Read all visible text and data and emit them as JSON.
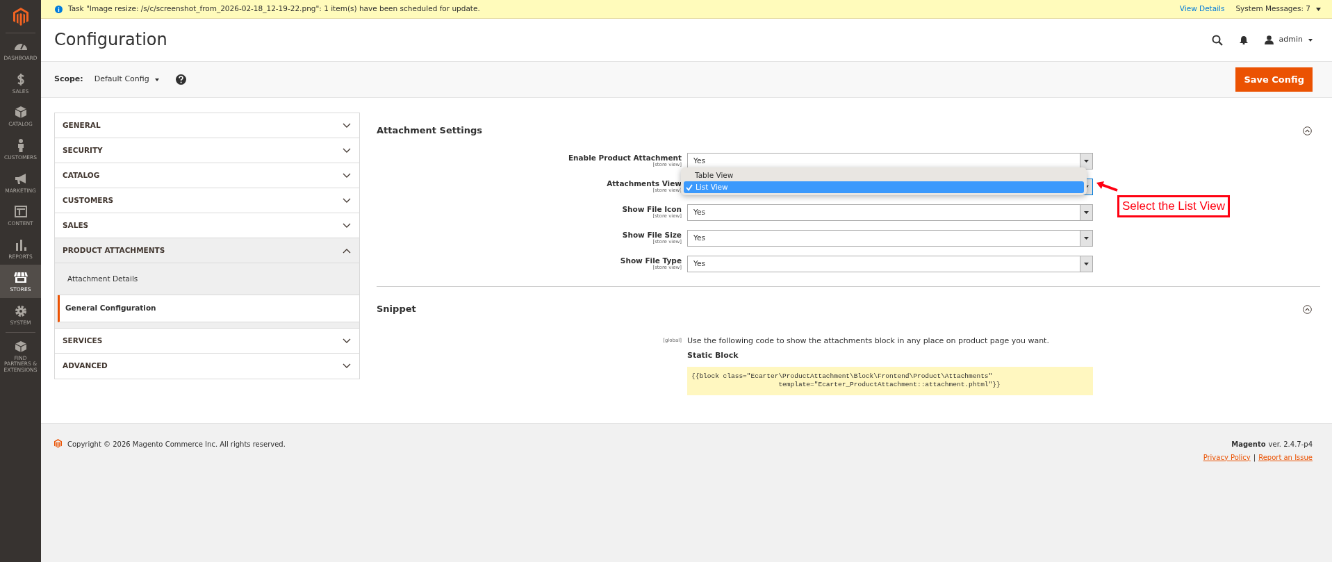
{
  "notice": {
    "text": "Task \"Image resize: /s/c/screenshot_from_2026-02-18_12-19-22.png\": 1 item(s) have been scheduled for update.",
    "link": "View Details",
    "messages": "System Messages: 7"
  },
  "sidebar": {
    "items": [
      {
        "label": "DASHBOARD",
        "selected": false
      },
      {
        "label": "SALES",
        "selected": false
      },
      {
        "label": "CATALOG",
        "selected": false
      },
      {
        "label": "CUSTOMERS",
        "selected": false
      },
      {
        "label": "MARKETING",
        "selected": false
      },
      {
        "label": "CONTENT",
        "selected": false
      },
      {
        "label": "REPORTS",
        "selected": false
      },
      {
        "label": "STORES",
        "selected": true
      },
      {
        "label": "SYSTEM",
        "selected": false
      },
      {
        "label": "FIND PARTNERS & EXTENSIONS",
        "selected": false
      }
    ]
  },
  "header": {
    "title": "Configuration",
    "user": "admin"
  },
  "scope": {
    "label": "Scope:",
    "value": "Default Config",
    "save_button": "Save Config"
  },
  "config_nav": [
    {
      "label": "GENERAL",
      "expanded": false
    },
    {
      "label": "SECURITY",
      "expanded": false
    },
    {
      "label": "CATALOG",
      "expanded": false
    },
    {
      "label": "CUSTOMERS",
      "expanded": false
    },
    {
      "label": "SALES",
      "expanded": false
    },
    {
      "label": "PRODUCT ATTACHMENTS",
      "expanded": true,
      "children": [
        {
          "label": "Attachment Details",
          "selected": false
        },
        {
          "label": "General Configuration",
          "selected": true
        }
      ]
    },
    {
      "label": "SERVICES",
      "expanded": false
    },
    {
      "label": "ADVANCED",
      "expanded": false
    }
  ],
  "attachment_settings": {
    "title": "Attachment Settings",
    "expanded": true,
    "fields": [
      {
        "label": "Enable Product Attachment",
        "scope": "[store view]",
        "value": "Yes"
      },
      {
        "label": "Attachments View",
        "scope": "[store view]",
        "dropdown": [
          {
            "label": "Table View",
            "selected": false
          },
          {
            "label": "List View",
            "selected": true
          }
        ],
        "annotation": "Select the List View"
      },
      {
        "label": "Show File Icon",
        "scope": "[store view]",
        "value": "Yes"
      },
      {
        "label": "Show File Size",
        "scope": "[store view]",
        "value": "Yes"
      },
      {
        "label": "Show File Type",
        "scope": "[store view]",
        "value": "Yes"
      }
    ]
  },
  "snippet": {
    "title": "Snippet",
    "expanded": true,
    "scope": "[global]",
    "text": "Use the following code to show the attachments block in any place on product page you want.",
    "heading": "Static Block",
    "code": "{{block class=\"Ecarter\\ProductAttachment\\Block\\Frontend\\Product\\Attachments\"\n                      template=\"Ecarter_ProductAttachment::attachment.phtml\"}}"
  },
  "footer": {
    "copyright": "Copyright © 2026 Magento Commerce Inc. All rights reserved.",
    "brand": "Magento",
    "version": "ver. 2.4.7-p4",
    "links": [
      "Privacy Policy",
      "Report an Issue"
    ],
    "separator": "|"
  }
}
